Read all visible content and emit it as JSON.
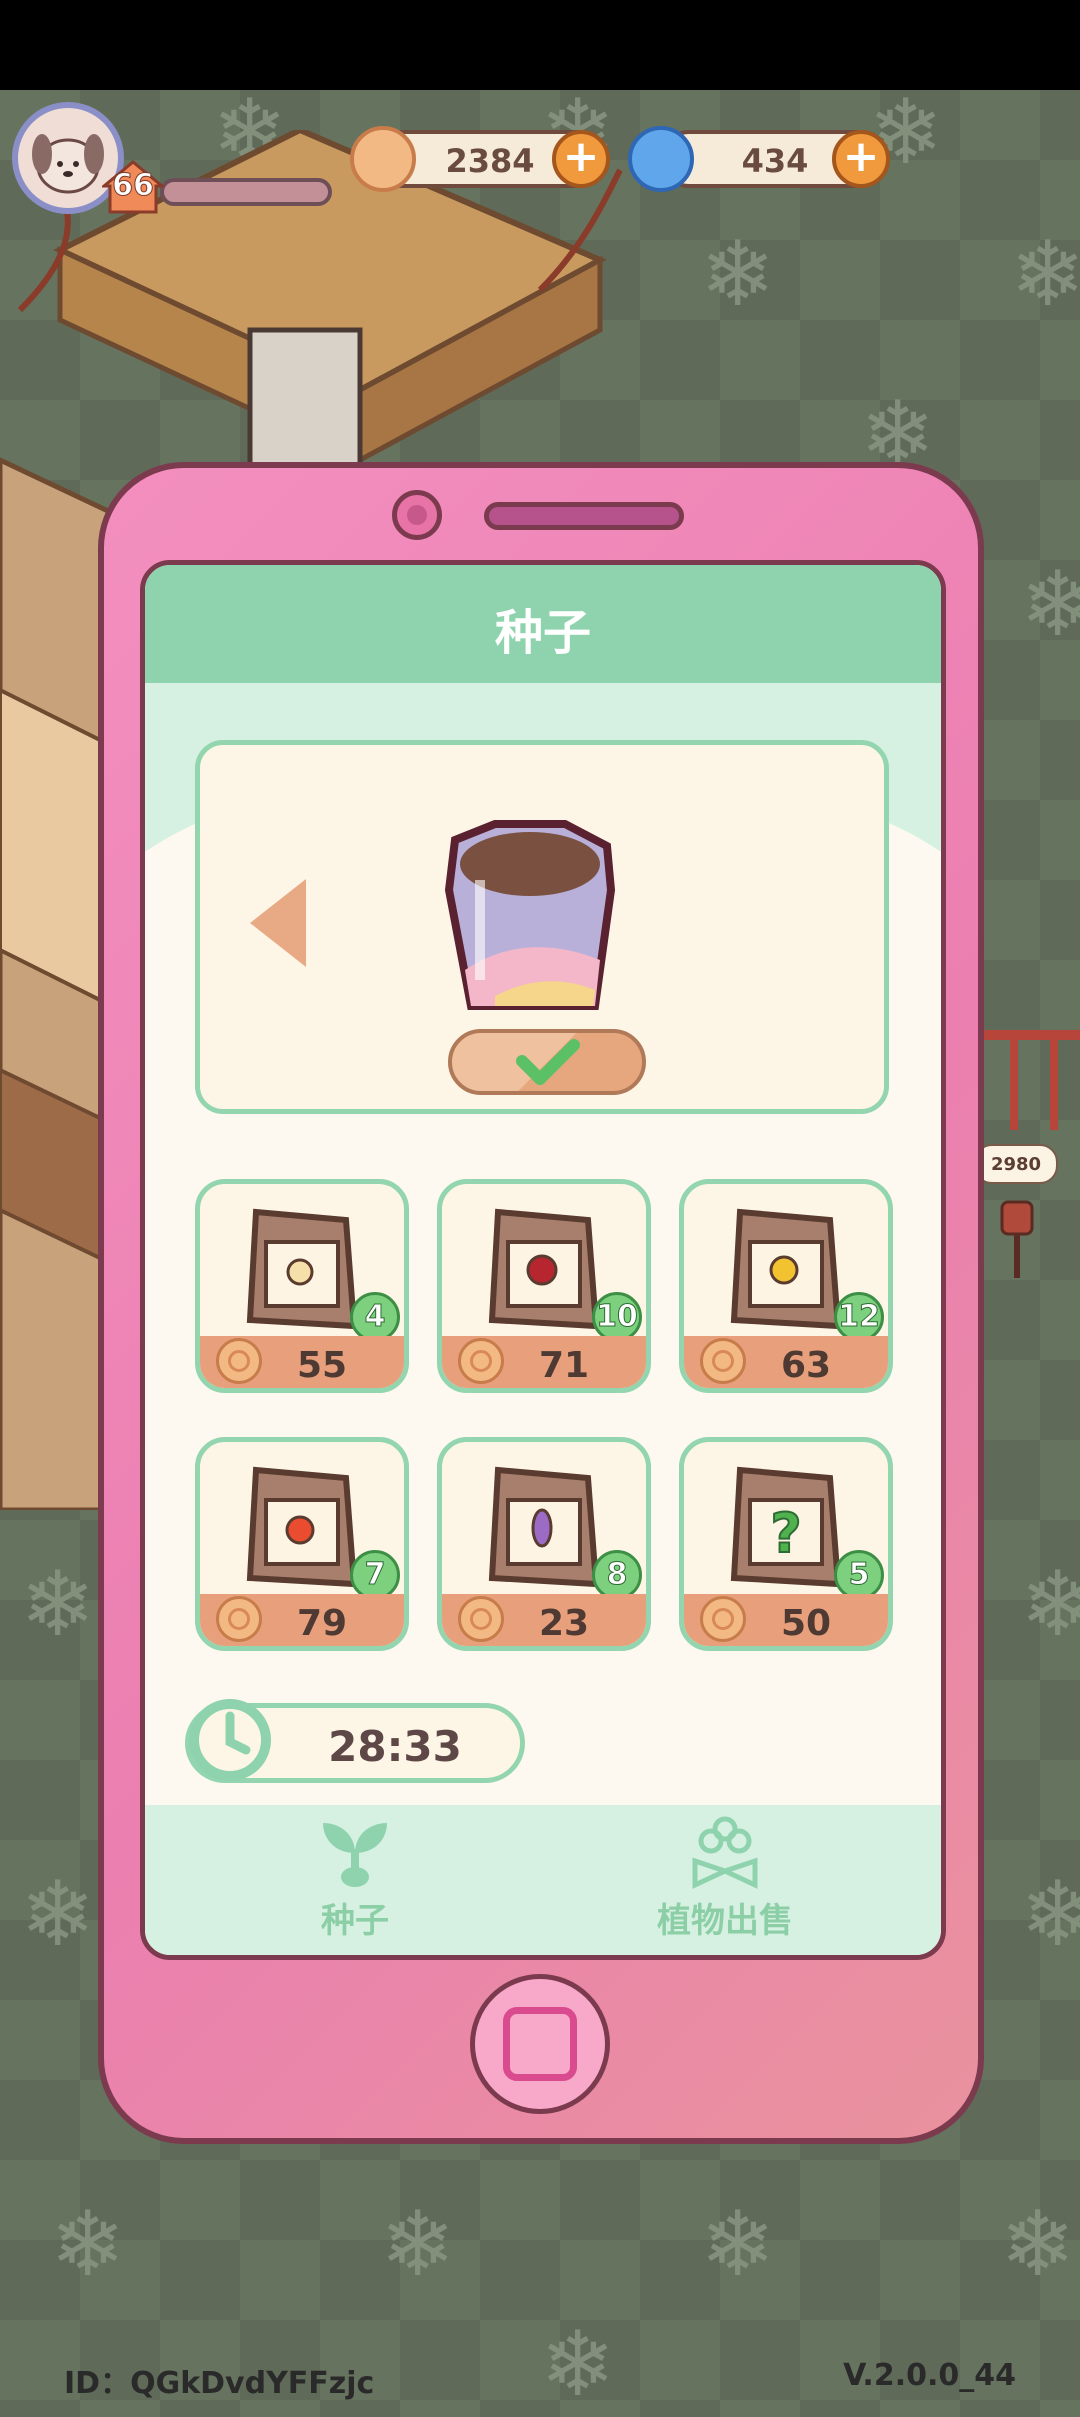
{
  "hud": {
    "level": "66",
    "coins": "2384",
    "gems": "434"
  },
  "background": {
    "bubble_value": "2980"
  },
  "panel": {
    "title": "种子"
  },
  "seeds": [
    {
      "count": "4",
      "price": "55",
      "flower_color": "#f4e0a8"
    },
    {
      "count": "10",
      "price": "71",
      "flower_color": "#b7262f"
    },
    {
      "count": "12",
      "price": "63",
      "flower_color": "#f2c230"
    },
    {
      "count": "7",
      "price": "79",
      "flower_color": "#e94c2f"
    },
    {
      "count": "8",
      "price": "23",
      "flower_color": "#9b6bc6"
    },
    {
      "count": "5",
      "price": "50",
      "flower_color": "#4fb24f"
    }
  ],
  "timer": {
    "value": "28:33"
  },
  "nav": {
    "seeds_label": "种子",
    "sell_label": "植物出售"
  },
  "footer": {
    "id": "ID：QGkDvdYFFzjc",
    "version": "V.2.0.0_44"
  },
  "colors": {
    "phone_pink": "#eb7fb0",
    "mint": "#8fd3ae",
    "cream": "#fdf9f0"
  }
}
